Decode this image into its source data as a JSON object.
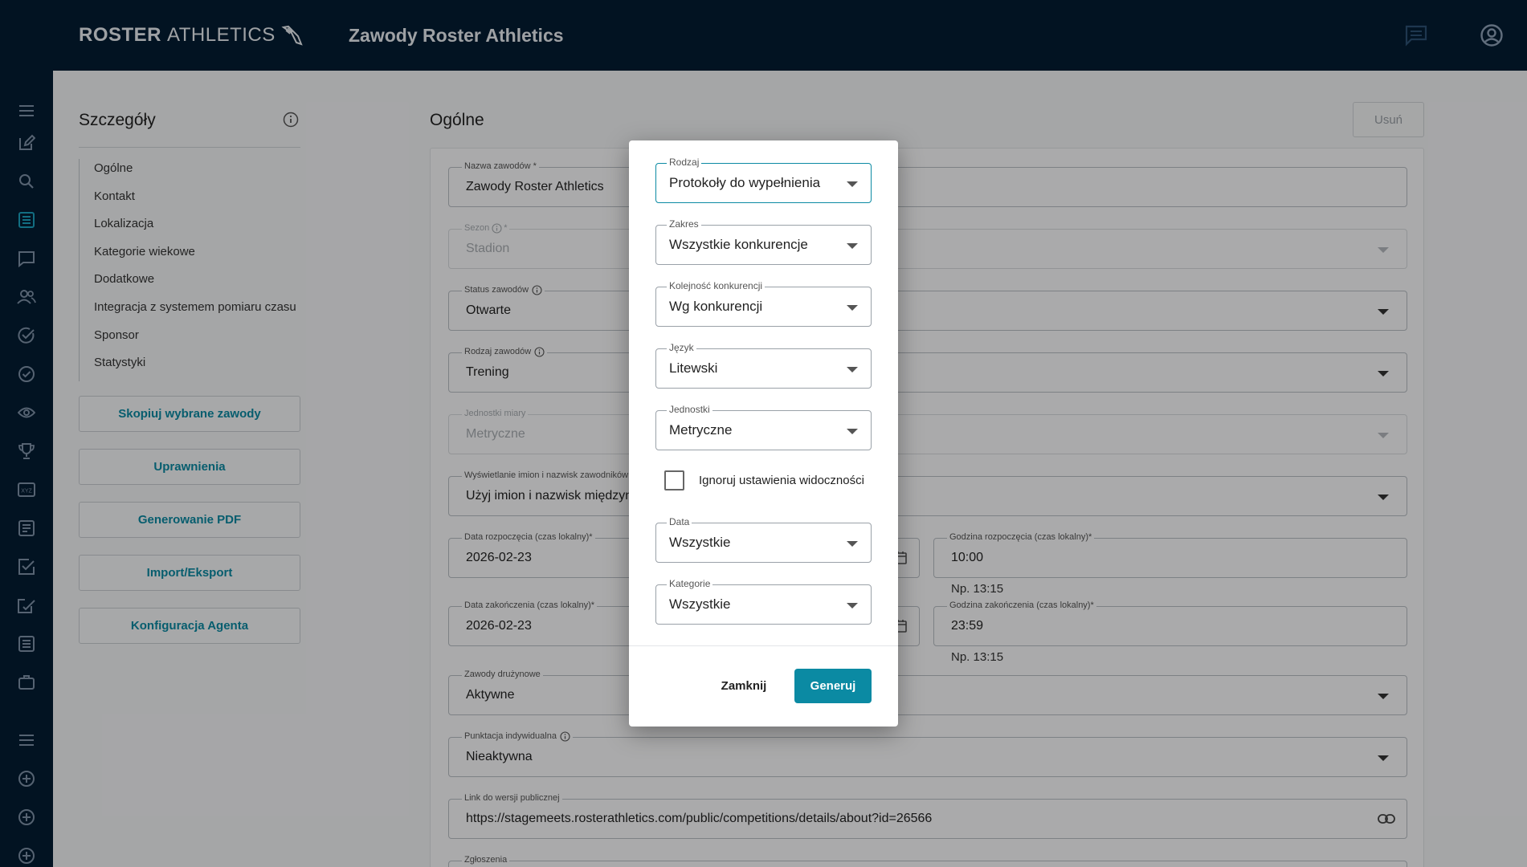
{
  "brand": {
    "bold": "ROSTER",
    "light": "ATHLETICS"
  },
  "app_title": "Zawody Roster Athletics",
  "topbar_icons": {
    "chat": "chat-icon",
    "account": "account-circle-icon"
  },
  "sidebar_icons": [
    "menu-icon",
    "edit-icon",
    "search-icon",
    "list-icon",
    "message-icon",
    "people-icon",
    "check-circle-icon",
    "check-circle-icon",
    "eye-icon",
    "trophy-icon",
    "xyz-icon",
    "document-list-icon",
    "checkbox-icon",
    "edit-check-icon",
    "list-icon",
    "briefcase-icon",
    "menu-icon",
    "add-circle-icon",
    "add-circle-icon",
    "add-circle-icon"
  ],
  "details": {
    "title": "Szczegóły",
    "nav": [
      "Ogólne",
      "Kontakt",
      "Lokalizacja",
      "Kategorie wiekowe",
      "Dodatkowe",
      "Integracja z systemem pomiaru czasu",
      "Sponsor",
      "Statystyki"
    ],
    "buttons": [
      "Skopiuj wybrane zawody",
      "Uprawnienia",
      "Generowanie PDF",
      "Import/Eksport",
      "Konfiguracja Agenta"
    ]
  },
  "main": {
    "title": "Ogólne",
    "delete_label": "Usuń",
    "fields": {
      "name": {
        "label": "Nazwa zawodów *",
        "value": "Zawody Roster Athletics"
      },
      "season": {
        "label": "Sezon",
        "suffix": "*",
        "value": "Stadion"
      },
      "status": {
        "label": "Status zawodów",
        "value": "Otwarte"
      },
      "type": {
        "label": "Rodzaj zawodów",
        "value": "Trening"
      },
      "units": {
        "label": "Jednostki miary",
        "value": "Metryczne"
      },
      "names": {
        "label": "Wyświetlanie imion i nazwisk zawodników",
        "value": "Użyj imion i nazwisk międzyna"
      },
      "start_date": {
        "label": "Data rozpoczęcia (czas lokalny)*",
        "value": "2026-02-23"
      },
      "start_time": {
        "label": "Godzina rozpoczęcia (czas lokalny)*",
        "value": "10:00",
        "hint": "Np. 13:15"
      },
      "end_date": {
        "label": "Data zakończenia (czas lokalny)*",
        "value": "2026-02-23"
      },
      "end_time": {
        "label": "Godzina zakończenia (czas lokalny)*",
        "value": "23:59",
        "hint": "Np. 13:15"
      },
      "team": {
        "label": "Zawody drużynowe",
        "value": "Aktywne"
      },
      "individual": {
        "label": "Punktacja indywidualna",
        "value": "Nieaktywna"
      },
      "public_link": {
        "label": "Link do wersji publicznej",
        "value": "https://stagemeets.rosterathletics.com/public/competitions/details/about?id=26566"
      },
      "entries": {
        "label": "Zgłoszenia"
      }
    }
  },
  "dialog": {
    "fields": [
      {
        "label": "Rodzaj",
        "value": "Protokoły do wypełnienia"
      },
      {
        "label": "Zakres",
        "value": "Wszystkie konkurencje"
      },
      {
        "label": "Kolejność konkurencji",
        "value": "Wg konkurencji"
      },
      {
        "label": "Język",
        "value": "Litewski"
      },
      {
        "label": "Jednostki",
        "value": "Metryczne"
      },
      {
        "label": "Data",
        "value": "Wszystkie"
      },
      {
        "label": "Kategorie",
        "value": "Wszystkie"
      }
    ],
    "checkbox_label": "Ignoruj ustawienia widoczności",
    "checkbox_checked": false,
    "close_label": "Zamknij",
    "generate_label": "Generuj"
  },
  "colors": {
    "accent": "#0b8aa3",
    "navy": "#041c33"
  }
}
